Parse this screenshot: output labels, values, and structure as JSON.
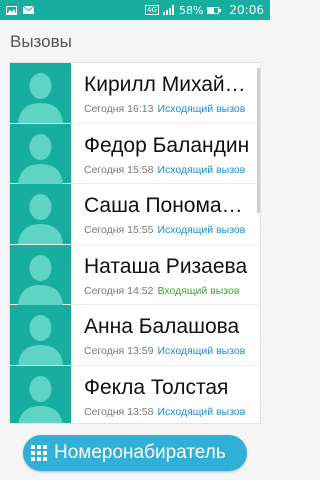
{
  "status_bar": {
    "lte": "4G",
    "battery": "58%",
    "battery_level": 0.58,
    "time": "20:06"
  },
  "header": {
    "title": "Вызовы"
  },
  "calls": [
    {
      "name": "Кирилл Михайлов",
      "time": "Сегодня 16:13",
      "type": "Исходящий вызов",
      "type_color": "#1a8fd0"
    },
    {
      "name": "Федор Баландин",
      "time": "Сегодня 15:58",
      "type": "Исходящий вызов",
      "type_color": "#1a8fd0"
    },
    {
      "name": "Саша Пономарев",
      "time": "Сегодня 15:55",
      "type": "Исходящий вызов",
      "type_color": "#1a8fd0"
    },
    {
      "name": "Наташа Ризаева",
      "time": "Сегодня 14:52",
      "type": "Входящий вызов",
      "type_color": "#3aa83a"
    },
    {
      "name": "Анна Балашова",
      "time": "Сегодня 13:59",
      "type": "Исходящий вызов",
      "type_color": "#1a8fd0"
    },
    {
      "name": "Фекла Толстая",
      "time": "Сегодня 13:58",
      "type": "Исходящий вызов",
      "type_color": "#1a8fd0"
    }
  ],
  "dialer": {
    "label": "Номеронабиратель"
  },
  "colors": {
    "accent": "#17ad9f",
    "dialer": "#2fb0d6"
  },
  "icons": {
    "status_left": [
      "photo-icon",
      "mail-icon"
    ],
    "status_right": [
      "lte-icon",
      "signal-icon",
      "battery-icon"
    ],
    "avatar": "person-icon",
    "dialer": "dialpad-icon"
  }
}
